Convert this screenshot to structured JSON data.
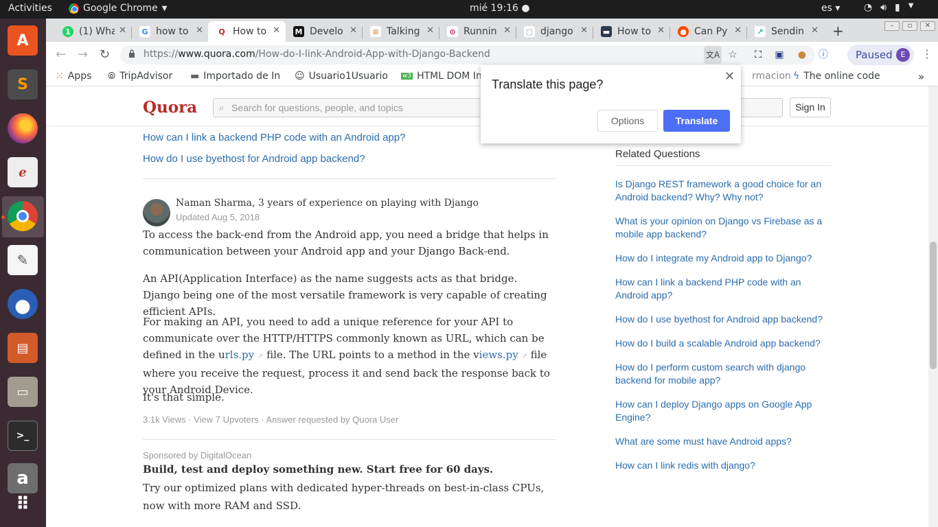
{
  "os_bar": {
    "activities": "Activities",
    "app_name": "Google Chrome",
    "app_menu_icon": "chevron-down-icon",
    "clock": "mié 19:16",
    "language": "es"
  },
  "dock": {
    "items": [
      {
        "name": "ubuntu-software",
        "icon": "shopping-bag-icon",
        "color": "#e95420",
        "glyph": "A"
      },
      {
        "name": "sublime-text",
        "icon": "sublime-icon",
        "color": "#4b4b4b",
        "glyph": "S"
      },
      {
        "name": "firefox",
        "icon": "firefox-icon",
        "color": "#ff7139",
        "glyph": ""
      },
      {
        "name": "document-viewer",
        "icon": "pdf-icon",
        "color": "#e6e6e6",
        "glyph": ""
      },
      {
        "name": "chrome",
        "icon": "chrome-icon",
        "color": "#4285f4",
        "glyph": ""
      },
      {
        "name": "text-editor",
        "icon": "notepad-icon",
        "color": "#f2f2f2",
        "glyph": ""
      },
      {
        "name": "thunderbird",
        "icon": "thunderbird-icon",
        "color": "#2a5fb8",
        "glyph": ""
      },
      {
        "name": "impress",
        "icon": "presentation-icon",
        "color": "#d35a2a",
        "glyph": ""
      },
      {
        "name": "files",
        "icon": "file-cabinet-icon",
        "color": "#a39b8f",
        "glyph": ""
      },
      {
        "name": "terminal",
        "icon": "terminal-icon",
        "color": "#2c2c2c",
        "glyph": ">_"
      },
      {
        "name": "amazon",
        "icon": "amazon-icon",
        "color": "#6e6e6e",
        "glyph": "a"
      },
      {
        "name": "show-apps",
        "icon": "app-grid-icon",
        "color": "transparent",
        "glyph": "⠿"
      }
    ]
  },
  "tabs": [
    {
      "title": "(1) Wha",
      "icon": "whatsapp-icon",
      "icon_color": "#25d366",
      "icon_glyph": "1",
      "active": false
    },
    {
      "title": "how to",
      "icon": "google-icon",
      "icon_color": "#ffffff",
      "icon_glyph": "G",
      "active": false
    },
    {
      "title": "How to",
      "icon": "quora-icon",
      "icon_color": "#ffffff",
      "icon_glyph": "Q",
      "active": true
    },
    {
      "title": "Develo",
      "icon": "medium-icon",
      "icon_color": "#111111",
      "icon_glyph": "M",
      "active": false
    },
    {
      "title": "Talking",
      "icon": "stackoverflow-icon",
      "icon_color": "#ffffff",
      "icon_glyph": "≡",
      "active": false
    },
    {
      "title": "Runnin",
      "icon": "record-icon",
      "icon_color": "#ffffff",
      "icon_glyph": "⊙",
      "active": false
    },
    {
      "title": "django",
      "icon": "doc-icon",
      "icon_color": "#ffffff",
      "icon_glyph": "▢",
      "active": false
    },
    {
      "title": "How to",
      "icon": "site-icon",
      "icon_color": "#2b3a4a",
      "icon_glyph": "▬",
      "active": false
    },
    {
      "title": "Can Py",
      "icon": "reddit-icon",
      "icon_color": "#ff4500",
      "icon_glyph": "●",
      "active": false
    },
    {
      "title": "Sendin",
      "icon": "feather-icon",
      "icon_color": "#ffffff",
      "icon_glyph": "↗",
      "active": false
    }
  ],
  "address_bar": {
    "url_prefix": "https://",
    "url_domain": "www.quora.com",
    "url_path": "/How-do-I-link-Android-App-with-Django-Backend",
    "paused_label": "Paused",
    "avatar_letter": "E"
  },
  "bookmarks": [
    {
      "label": "Apps",
      "icon": "apps-grid-icon"
    },
    {
      "label": "TripAdvisor",
      "icon": "tripadvisor-icon"
    },
    {
      "label": "Importado de In",
      "icon": "folder-icon"
    },
    {
      "label": "Usuario1Usuario",
      "icon": "smiley-icon"
    },
    {
      "label": "HTML DOM In",
      "icon": "w3-icon"
    },
    {
      "label": "rmacion",
      "icon": ""
    },
    {
      "label": "The online code",
      "icon": "lightning-icon"
    }
  ],
  "quora": {
    "logo": "Quora",
    "search_placeholder": "Search for questions, people, and topics",
    "sign_in": "Sign In"
  },
  "main": {
    "top_links": [
      "How can I link a backend PHP code with an Android app?",
      "How do I use byethost for Android app backend?"
    ],
    "answer": {
      "author": "Naman Sharma, 3 years of experience on playing with Django",
      "updated": "Updated Aug 5, 2018",
      "para1": "To access the back-end from the Android app, you need a bridge that helps in communication between your Android app and your Django Back-end.",
      "para2": "An API(Application Interface) as the name suggests acts as that bridge. Django being one of the most versatile framework is very capable of creating efficient APIs.",
      "para3_a": "For making an API, you need to add a unique reference for your API to communicate over the HTTP/HTTPS commonly known as URL, which can be defined in the u",
      "para3_link1": "rls.py",
      "para3_b": " file. The URL points to a method in the v",
      "para3_link2": "iews.py",
      "para3_c": " file where you receive the request, process it and send back the response back to your Android Device.",
      "para4": "It's that simple.",
      "meta": "3.1k Views · View 7 Upvoters · Answer requested by Quora User"
    },
    "ad": {
      "sponsored": "Sponsored by DigitalOcean",
      "title": "Build, test and deploy something new. Start free for 60 days.",
      "body": "Try our optimized plans with dedicated hyper-threads on best-in-class CPUs, now with more RAM and SSD."
    }
  },
  "sidebar": {
    "title": "Related Questions",
    "questions": [
      "Is Django REST framework a good choice for an Android backend? Why? Why not?",
      "What is your opinion on Django vs Firebase as a mobile app backend?",
      "How do I integrate my Android app to Django?",
      "How can I link a backend PHP code with an Android app?",
      "How do I use byethost for Android app backend?",
      "How do I build a scalable Android app backend?",
      "How do I perform custom search with django backend for mobile app?",
      "How can I deploy Django apps on Google App Engine?",
      "What are some must have Android apps?",
      "How can I link redis with django?"
    ]
  },
  "translate_popup": {
    "title": "Translate this page?",
    "options": "Options",
    "translate": "Translate"
  },
  "colors": {
    "quora_red": "#b92b27",
    "link_blue": "#2b6dad",
    "translate_blue": "#4c6ef5",
    "dock_bg": "#3b2a32"
  }
}
